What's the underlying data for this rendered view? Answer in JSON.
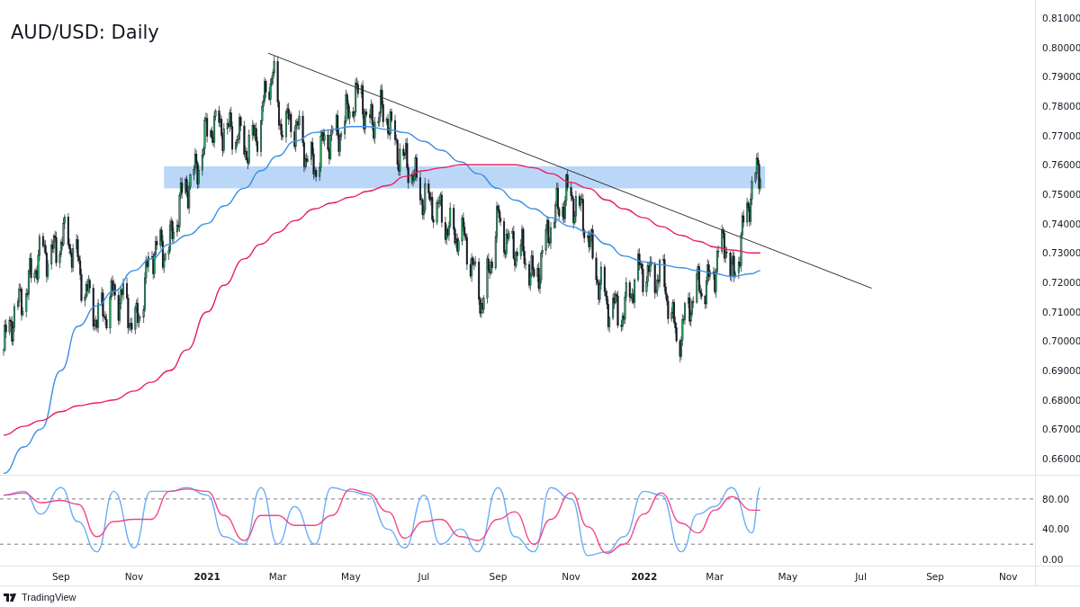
{
  "title": "AUD/USD: Daily",
  "price_chart": {
    "chart_data": {
      "type": "line",
      "x": [
        "2020-07-15",
        "2020-08-01",
        "2020-08-15",
        "2020-09-01",
        "2020-09-15",
        "2020-10-01",
        "2020-10-15",
        "2020-11-01",
        "2020-11-15",
        "2020-12-01",
        "2020-12-15",
        "2021-01-01",
        "2021-01-15",
        "2021-02-01",
        "2021-02-15",
        "2021-03-01",
        "2021-03-15",
        "2021-04-01",
        "2021-04-15",
        "2021-05-01",
        "2021-05-15",
        "2021-06-01",
        "2021-06-15",
        "2021-07-01",
        "2021-07-15",
        "2021-08-01",
        "2021-08-15",
        "2021-09-01",
        "2021-09-15",
        "2021-10-01",
        "2021-10-15",
        "2021-11-01",
        "2021-11-15",
        "2021-12-01",
        "2021-12-15",
        "2022-01-01",
        "2022-01-15",
        "2022-02-01",
        "2022-02-15",
        "2022-03-01",
        "2022-03-15",
        "2022-04-01",
        "2022-04-08"
      ],
      "series": [
        {
          "color": "#3a8ee6",
          "values": [
            0.655,
            0.664,
            0.67,
            0.69,
            0.705,
            0.712,
            0.717,
            0.724,
            0.728,
            0.733,
            0.736,
            0.74,
            0.746,
            0.752,
            0.758,
            0.763,
            0.768,
            0.771,
            0.772,
            0.773,
            0.773,
            0.772,
            0.771,
            0.768,
            0.765,
            0.761,
            0.757,
            0.752,
            0.748,
            0.745,
            0.742,
            0.739,
            0.737,
            0.733,
            0.729,
            0.727,
            0.726,
            0.725,
            0.724,
            0.723,
            0.722,
            0.723,
            0.724
          ]
        },
        {
          "color": "#e91e63",
          "values": [
            0.668,
            0.671,
            0.673,
            0.676,
            0.678,
            0.679,
            0.68,
            0.683,
            0.686,
            0.69,
            0.697,
            0.71,
            0.719,
            0.728,
            0.733,
            0.737,
            0.741,
            0.745,
            0.747,
            0.749,
            0.751,
            0.753,
            0.756,
            0.758,
            0.759,
            0.76,
            0.76,
            0.76,
            0.76,
            0.759,
            0.757,
            0.754,
            0.752,
            0.748,
            0.745,
            0.742,
            0.739,
            0.736,
            0.734,
            0.732,
            0.731,
            0.73,
            0.73
          ]
        }
      ],
      "xlim": [
        "2020-07-12",
        "2022-12-31"
      ],
      "ylim": [
        0.6545,
        0.8161
      ],
      "yticks": [
        {
          "value": 0.81,
          "label": "0.81000"
        },
        {
          "value": 0.8,
          "label": "0.80000"
        },
        {
          "value": 0.79,
          "label": "0.79000"
        },
        {
          "value": 0.78,
          "label": "0.78000"
        },
        {
          "value": 0.77,
          "label": "0.77000"
        },
        {
          "value": 0.76,
          "label": "0.76000"
        },
        {
          "value": 0.75,
          "label": "0.75000"
        },
        {
          "value": 0.74,
          "label": "0.74000"
        },
        {
          "value": 0.73,
          "label": "0.73000"
        },
        {
          "value": 0.72,
          "label": "0.72000"
        },
        {
          "value": 0.71,
          "label": "0.71000"
        },
        {
          "value": 0.7,
          "label": "0.70000"
        },
        {
          "value": 0.69,
          "label": "0.69000"
        },
        {
          "value": 0.68,
          "label": "0.68000"
        },
        {
          "value": 0.67,
          "label": "0.67000"
        },
        {
          "value": 0.66,
          "label": "0.66000"
        }
      ]
    }
  },
  "oscillator": {
    "chart_data": {
      "type": "line",
      "x": [
        "2020-07-15",
        "2020-08-01",
        "2020-08-15",
        "2020-09-01",
        "2020-09-15",
        "2020-10-01",
        "2020-10-15",
        "2020-11-01",
        "2020-11-15",
        "2020-12-01",
        "2020-12-15",
        "2021-01-01",
        "2021-01-15",
        "2021-02-01",
        "2021-02-15",
        "2021-03-01",
        "2021-03-15",
        "2021-04-01",
        "2021-04-15",
        "2021-05-01",
        "2021-05-15",
        "2021-06-01",
        "2021-06-15",
        "2021-07-01",
        "2021-07-15",
        "2021-08-01",
        "2021-08-15",
        "2021-09-01",
        "2021-09-15",
        "2021-10-01",
        "2021-10-15",
        "2021-11-01",
        "2021-11-15",
        "2021-12-01",
        "2021-12-15",
        "2022-01-01",
        "2022-01-15",
        "2022-02-01",
        "2022-02-15",
        "2022-03-01",
        "2022-03-15",
        "2022-04-01",
        "2022-04-08"
      ],
      "series": [
        {
          "color": "#6aaef5",
          "values": [
            85,
            90,
            60,
            95,
            50,
            10,
            90,
            15,
            90,
            90,
            95,
            85,
            30,
            20,
            95,
            20,
            70,
            20,
            95,
            90,
            85,
            40,
            15,
            85,
            20,
            40,
            10,
            95,
            30,
            10,
            95,
            80,
            5,
            10,
            30,
            90,
            85,
            10,
            60,
            70,
            95,
            35,
            95
          ]
        },
        {
          "color": "#f2458a",
          "values": [
            85,
            88,
            75,
            78,
            73,
            30,
            50,
            53,
            53,
            90,
            93,
            90,
            58,
            25,
            58,
            58,
            45,
            45,
            58,
            93,
            88,
            63,
            28,
            50,
            53,
            30,
            25,
            53,
            63,
            20,
            53,
            88,
            43,
            8,
            20,
            60,
            88,
            48,
            35,
            65,
            83,
            65,
            65
          ]
        }
      ],
      "xlim": [
        "2020-07-12",
        "2022-12-31"
      ],
      "ylim": [
        -8.4,
        110.8
      ],
      "xticks": [
        {
          "value": "2020-09-01",
          "label": "Sep"
        },
        {
          "value": "2020-11-01",
          "label": "Nov"
        },
        {
          "value": "2021-01-01",
          "label": "2021"
        },
        {
          "value": "2021-03-01",
          "label": "Mar"
        },
        {
          "value": "2021-05-01",
          "label": "May"
        },
        {
          "value": "2021-07-01",
          "label": "Jul"
        },
        {
          "value": "2021-09-01",
          "label": "Sep"
        },
        {
          "value": "2021-11-01",
          "label": "Nov"
        },
        {
          "value": "2022-01-01",
          "label": "2022"
        },
        {
          "value": "2022-03-01",
          "label": "Mar"
        },
        {
          "value": "2022-05-01",
          "label": "May"
        },
        {
          "value": "2022-07-01",
          "label": "Jul"
        },
        {
          "value": "2022-09-01",
          "label": "Sep"
        },
        {
          "value": "2022-11-01",
          "label": "Nov"
        }
      ],
      "yticks": [
        {
          "value": 80,
          "label": "80.00"
        },
        {
          "value": 40,
          "label": "40.00"
        },
        {
          "value": 0,
          "label": "0.00"
        }
      ]
    }
  },
  "footer": {
    "brand": "TradingView"
  }
}
